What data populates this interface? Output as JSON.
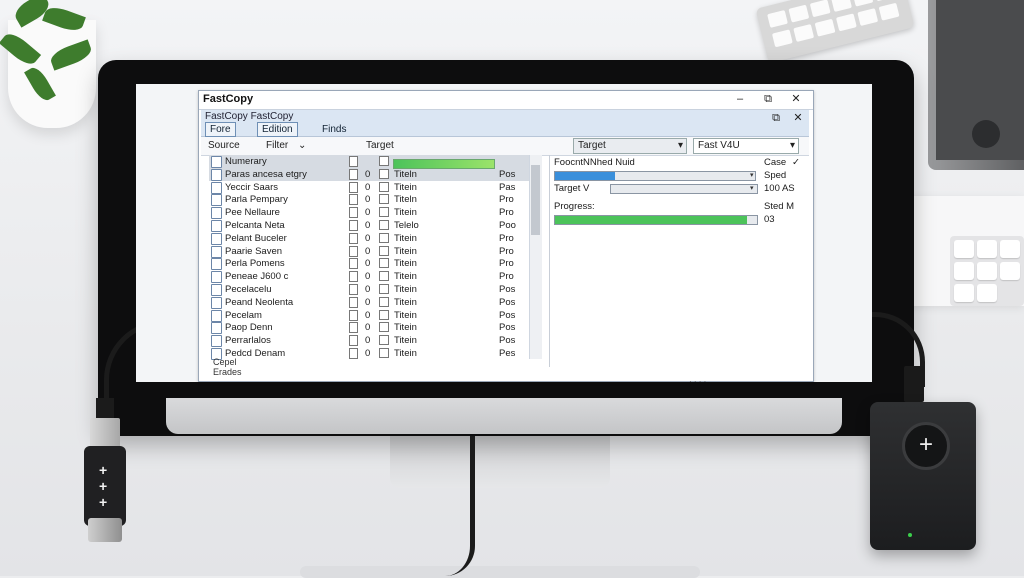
{
  "window": {
    "title": "FastCopy",
    "min_glyph": "–",
    "restore_glyph": "⧉",
    "close_glyph": "✕"
  },
  "menubar": {
    "line1": "FastCopy FastCopy",
    "tabs": [
      {
        "label": "Fore",
        "active": true
      },
      {
        "label": "Edition",
        "active": true
      },
      {
        "label": "Finds",
        "active": false
      }
    ],
    "restore_glyph": "⧉",
    "close_glyph": "✕"
  },
  "columns": {
    "source": "Source",
    "filter": "Filter",
    "filter_arrow": "⌄",
    "target": "Target",
    "target_select": "Target",
    "fast_mode": "Fast V4U",
    "arrow": "▾"
  },
  "files": [
    {
      "name": "Numerary",
      "selected": true,
      "d": "",
      "target": "",
      "size": ""
    },
    {
      "name": "Paras ancesa etgry",
      "selected": true,
      "d": "0",
      "target": "Titeln",
      "size": "Pos"
    },
    {
      "name": "Yeccir Saars",
      "selected": false,
      "d": "0",
      "target": "Titein",
      "size": "Pas"
    },
    {
      "name": "Parla Pempary",
      "selected": false,
      "d": "0",
      "target": "Titeln",
      "size": "Pro"
    },
    {
      "name": "Pee Nellaure",
      "selected": false,
      "d": "0",
      "target": "Titein",
      "size": "Pro"
    },
    {
      "name": "Pelcanta Neta",
      "selected": false,
      "d": "0",
      "target": "Telelo",
      "size": "Poo"
    },
    {
      "name": "Pelant Buceler",
      "selected": false,
      "d": "0",
      "target": "Titein",
      "size": "Pro"
    },
    {
      "name": "Paarie Saven",
      "selected": false,
      "d": "0",
      "target": "Titein",
      "size": "Pro"
    },
    {
      "name": "Perla Pomens",
      "selected": false,
      "d": "0",
      "target": "Titein",
      "size": "Pro"
    },
    {
      "name": "Peneae J600 c",
      "selected": false,
      "d": "0",
      "target": "Titein",
      "size": "Pro"
    },
    {
      "name": "Pecelacelu",
      "selected": false,
      "d": "0",
      "target": "Titein",
      "size": "Pos"
    },
    {
      "name": "Peand Neolenta",
      "selected": false,
      "d": "0",
      "target": "Titein",
      "size": "Pos"
    },
    {
      "name": "Pecelam",
      "selected": false,
      "d": "0",
      "target": "Titein",
      "size": "Pos"
    },
    {
      "name": "Paop Denn",
      "selected": false,
      "d": "0",
      "target": "Titein",
      "size": "Pos"
    },
    {
      "name": "Perrarlalos",
      "selected": false,
      "d": "0",
      "target": "Titein",
      "size": "Pos"
    },
    {
      "name": "Pedcd Denam",
      "selected": false,
      "d": "0",
      "target": "Titein",
      "size": "Pes"
    }
  ],
  "list_status": {
    "line1": "Cepel",
    "line2": "Erades"
  },
  "right": {
    "source_label": "FoocntNNhed Nuid",
    "case_label": "Case",
    "case_arrow": "✓",
    "speed_label": "Sped",
    "target_label": "Target V",
    "target_value": "100 AS",
    "progress_label": "Progress:",
    "speed_value": "Sted M",
    "progress_percent": "03",
    "progress_fraction": 0.95,
    "source_fill": 0.3,
    "arrow": "▾"
  },
  "footer_hint": "· · · ·",
  "colors": {
    "accent": "#3a8fdb",
    "progress": "#4cc35a",
    "window_border": "#9aa7b8"
  }
}
